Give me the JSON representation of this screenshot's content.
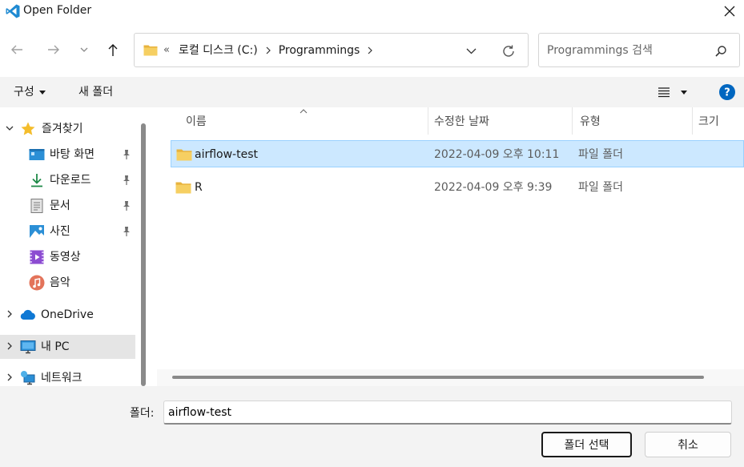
{
  "window": {
    "title": "Open Folder"
  },
  "address": {
    "overflow": "«",
    "crumbs": [
      "로컬 디스크 (C:)",
      "Programmings"
    ]
  },
  "search": {
    "placeholder": "Programmings 검색"
  },
  "toolbar": {
    "organize_label": "구성",
    "new_folder_label": "새 폴더"
  },
  "sidebar": {
    "quick_access": {
      "label": "즐겨찾기",
      "items": [
        {
          "label": "바탕 화면",
          "icon": "desktop-icon",
          "pinned": true
        },
        {
          "label": "다운로드",
          "icon": "download-icon",
          "pinned": true
        },
        {
          "label": "문서",
          "icon": "document-icon",
          "pinned": true
        },
        {
          "label": "사진",
          "icon": "pictures-icon",
          "pinned": true
        },
        {
          "label": "동영상",
          "icon": "videos-icon",
          "pinned": false
        },
        {
          "label": "음악",
          "icon": "music-icon",
          "pinned": false
        }
      ]
    },
    "onedrive": {
      "label": "OneDrive"
    },
    "this_pc": {
      "label": "내 PC"
    },
    "network": {
      "label": "네트워크"
    }
  },
  "columns": {
    "name": "이름",
    "date": "수정한 날짜",
    "type": "유형",
    "size": "크기"
  },
  "files": [
    {
      "name": "airflow-test",
      "date": "2022-04-09 오후 10:11",
      "type": "파일 폴더",
      "selected": true
    },
    {
      "name": "R",
      "date": "2022-04-09 오후 9:39",
      "type": "파일 폴더",
      "selected": false
    }
  ],
  "footer": {
    "folder_label": "폴더:",
    "folder_value": "airflow-test",
    "select_button": "폴더 선택",
    "cancel_button": "취소"
  },
  "colors": {
    "accent": "#0067c0",
    "selection": "#cce8ff",
    "folder": "#f2c55c"
  }
}
